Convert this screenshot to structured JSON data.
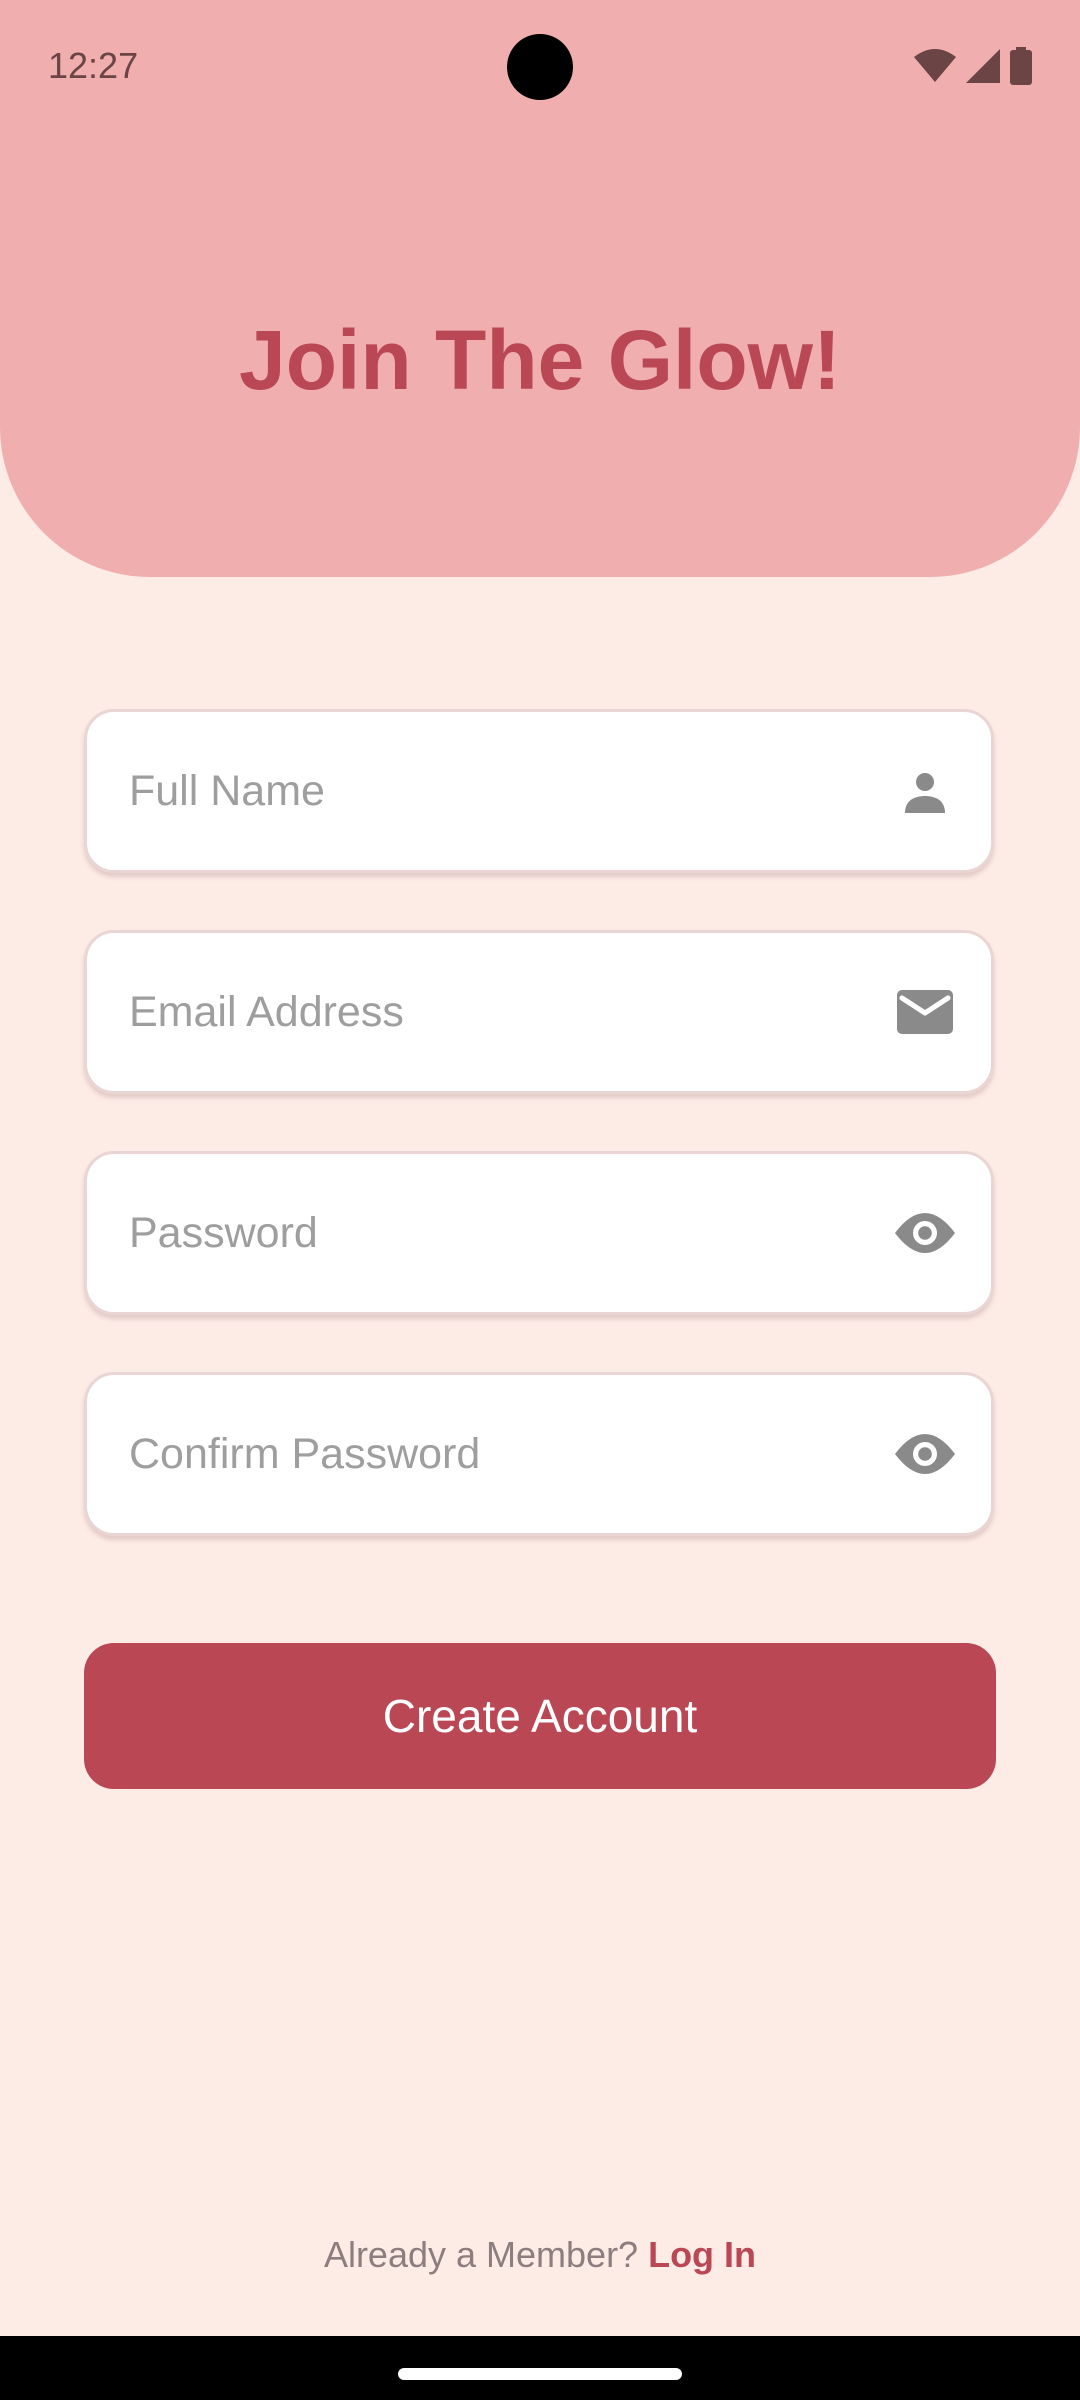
{
  "status_bar": {
    "time": "12:27"
  },
  "header": {
    "title": "Join The Glow!"
  },
  "form": {
    "full_name": {
      "placeholder": "Full Name",
      "value": "",
      "icon": "person-icon"
    },
    "email": {
      "placeholder": "Email Address",
      "value": "",
      "icon": "mail-icon"
    },
    "password": {
      "placeholder": "Password",
      "value": "",
      "icon": "eye-icon"
    },
    "confirm_password": {
      "placeholder": "Confirm Password",
      "value": "",
      "icon": "eye-icon"
    },
    "submit_label": "Create Account"
  },
  "footer": {
    "prompt": "Already a Member?",
    "login_label": "Log In"
  },
  "colors": {
    "header_bg": "#F0AEAF",
    "page_bg": "#FDEBE6",
    "accent": "#B94754",
    "icon": "#8A8A8A",
    "placeholder": "#9E9E9E"
  }
}
